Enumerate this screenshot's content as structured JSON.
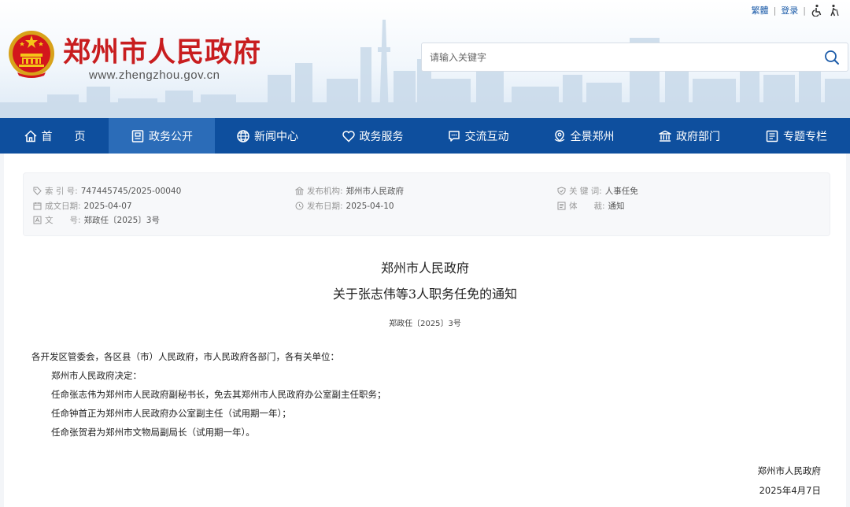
{
  "header": {
    "site_title": "郑州市人民政府",
    "site_url": "www.zhengzhou.gov.cn",
    "toplinks": {
      "traditional": "繁體",
      "separator": "|",
      "login": "登录"
    },
    "search": {
      "placeholder": "请输入关键字",
      "value": ""
    }
  },
  "nav": {
    "items": [
      {
        "label": "首　　页",
        "icon": "home-icon"
      },
      {
        "label": "政务公开",
        "icon": "document-icon",
        "active": true
      },
      {
        "label": "新闻中心",
        "icon": "globe-icon"
      },
      {
        "label": "政务服务",
        "icon": "heart-icon"
      },
      {
        "label": "交流互动",
        "icon": "chat-icon"
      },
      {
        "label": "全景郑州",
        "icon": "panorama-icon"
      },
      {
        "label": "政府部门",
        "icon": "building-icon"
      },
      {
        "label": "专题专栏",
        "icon": "book-icon"
      }
    ],
    "bg_color": "#0e4f9e",
    "active_color": "#2b6cb8"
  },
  "meta": {
    "index_label": "索 引 号:",
    "index_value": "747445745/2025-00040",
    "publisher_label": "发布机构:",
    "publisher_value": "郑州市人民政府",
    "keyword_label": "关 键 词:",
    "keyword_value": "人事任免",
    "created_label": "成文日期:",
    "created_value": "2025-04-07",
    "published_label": "发布日期:",
    "published_value": "2025-04-10",
    "genre_label": "体　　裁:",
    "genre_value": "通知",
    "docno_label": "文　　号:",
    "docno_value": "郑政任〔2025〕3号"
  },
  "document": {
    "title_line1": "郑州市人民政府",
    "title_line2": "关于张志伟等3人职务任免的通知",
    "doc_number": "郑政任〔2025〕3号",
    "salutation": "各开发区管委会，各区县（市）人民政府，市人民政府各部门，各有关单位：",
    "paragraphs": [
      "郑州市人民政府决定：",
      "任命张志伟为郑州市人民政府副秘书长，免去其郑州市人民政府办公室副主任职务；",
      "任命钟首正为郑州市人民政府办公室副主任（试用期一年）；",
      "任命张贺君为郑州市文物局副局长（试用期一年）。"
    ],
    "signer": "郑州市人民政府",
    "sign_date": "2025年4月7日"
  },
  "colors": {
    "title_red": "#c81d1f",
    "link_blue": "#1a5aa8"
  }
}
